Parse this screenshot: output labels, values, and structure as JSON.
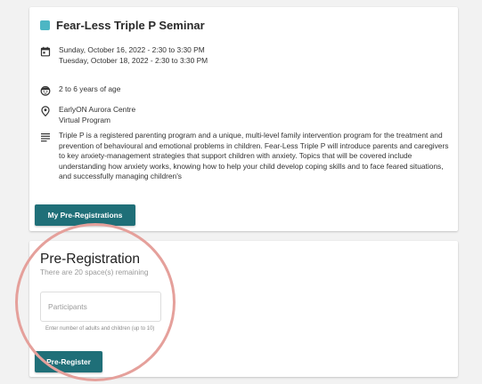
{
  "colors": {
    "background": "#f2f2f2",
    "card": "#ffffff",
    "event_swatch": "#4db6c4",
    "button": "#1f6f78",
    "highlight_ring": "#e5a09b"
  },
  "event": {
    "title": "Fear-Less Triple P Seminar",
    "swatch_color": "#4db6c4",
    "dates": [
      "Sunday, October 16, 2022 - 2:30 to 3:30 PM",
      "Tuesday, October 18, 2022 - 2:30 to 3:30 PM"
    ],
    "age": "2 to 6 years of age",
    "locations": [
      "EarlyON Aurora Centre",
      "Virtual Program"
    ],
    "description": "Triple P is a registered parenting program and a unique, multi-level family intervention program for the treatment and prevention of behavioural and emotional problems in children. Fear-Less Triple P will introduce parents and caregivers to key anxiety-management strategies that support children with anxiety. Topics that will be covered include understanding how anxiety works, knowing how to help your child develop coping skills and to face feared situations, and successfully managing children's",
    "my_prereg_button": "My Pre-Registrations",
    "icons": {
      "dates": "calendar-icon",
      "age": "child-face-icon",
      "location": "location-pin-icon",
      "description": "text-lines-icon"
    }
  },
  "prereg": {
    "title": "Pre-Registration",
    "spaces_text": "There are 20 space(s) remaining",
    "participants_placeholder": "Participants",
    "helper_text": "Enter number of adults and children (up to 10)",
    "submit_button": "Pre-Register"
  }
}
